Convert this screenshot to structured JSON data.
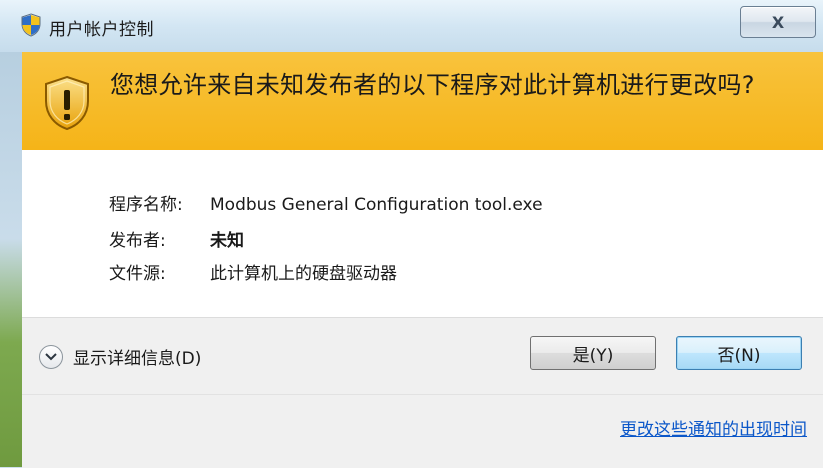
{
  "window": {
    "title": "用户帐户控制",
    "close_label": "X",
    "icon": "uac-shield-icon"
  },
  "banner": {
    "icon": "warning-shield-icon",
    "question": "您想允许来自未知发布者的以下程序对此计算机进行更改吗?"
  },
  "details_info": {
    "program_label": "程序名称:",
    "program_value": "Modbus General Configuration tool.exe",
    "publisher_label": "发布者:",
    "publisher_value": "未知",
    "source_label": "文件源:",
    "source_value": "此计算机上的硬盘驱动器"
  },
  "buttons": {
    "show_details_label": "显示详细信息(D)",
    "yes_label": "是(Y)",
    "no_label": "否(N)"
  },
  "footer": {
    "link_text": "更改这些通知的出现时间"
  },
  "colors": {
    "banner": "#f5b418",
    "link": "#0b57c9",
    "default_button_border": "#3c7fb1"
  }
}
